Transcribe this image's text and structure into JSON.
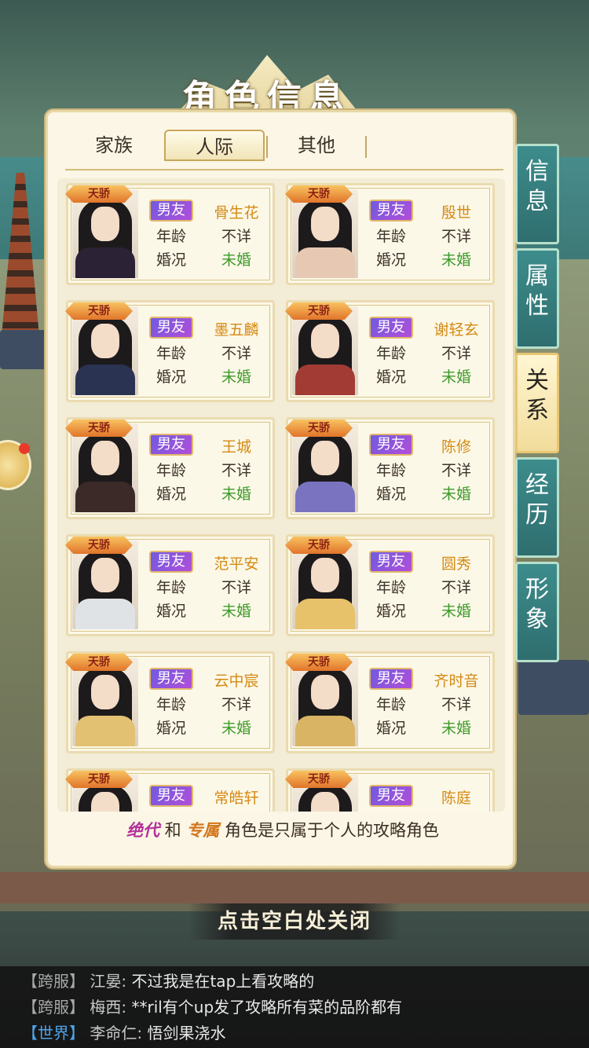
{
  "title": "角色信息",
  "tabs": [
    "家族",
    "人际",
    "其他"
  ],
  "active_tab": "人际",
  "side_tabs": [
    "信息",
    "属性",
    "关系",
    "经历",
    "形象"
  ],
  "active_side_tab": "关系",
  "labels": {
    "age": "年龄",
    "marriage": "婚况"
  },
  "characters": [
    {
      "badge": "天骄",
      "tag": "男友",
      "name": "骨生花",
      "age": "不详",
      "marriage": "未婚",
      "robe": "#2b2236"
    },
    {
      "badge": "天骄",
      "tag": "男友",
      "name": "殷世",
      "age": "不详",
      "marriage": "未婚",
      "robe": "#e7c9b3"
    },
    {
      "badge": "天骄",
      "tag": "男友",
      "name": "墨五麟",
      "age": "不详",
      "marriage": "未婚",
      "robe": "#2a3352"
    },
    {
      "badge": "天骄",
      "tag": "男友",
      "name": "谢轻玄",
      "age": "不详",
      "marriage": "未婚",
      "robe": "#a33b35"
    },
    {
      "badge": "天骄",
      "tag": "男友",
      "name": "王城",
      "age": "不详",
      "marriage": "未婚",
      "robe": "#3b2a28"
    },
    {
      "badge": "天骄",
      "tag": "男友",
      "name": "陈修",
      "age": "不详",
      "marriage": "未婚",
      "robe": "#7a74c0"
    },
    {
      "badge": "天骄",
      "tag": "男友",
      "name": "范平安",
      "age": "不详",
      "marriage": "未婚",
      "robe": "#dfe3e6"
    },
    {
      "badge": "天骄",
      "tag": "男友",
      "name": "圆秀",
      "age": "不详",
      "marriage": "未婚",
      "robe": "#e8c16b"
    },
    {
      "badge": "天骄",
      "tag": "男友",
      "name": "云中宸",
      "age": "不详",
      "marriage": "未婚",
      "robe": "#e2c173"
    },
    {
      "badge": "天骄",
      "tag": "男友",
      "name": "齐时音",
      "age": "不详",
      "marriage": "未婚",
      "robe": "#d9b464"
    },
    {
      "badge": "天骄",
      "tag": "男友",
      "name": "常皓轩",
      "age": "",
      "marriage": "",
      "robe": "#b94a4a"
    },
    {
      "badge": "天骄",
      "tag": "男友",
      "name": "陈庭",
      "age": "",
      "marriage": "",
      "robe": "#3a3a3a"
    }
  ],
  "note": {
    "part1": "绝代",
    "and": "和",
    "part2": "专属",
    "rest": "角色是只属于个人的攻略角色"
  },
  "close_hint": "点击空白处关闭",
  "chat": [
    {
      "channel": "【跨服】",
      "sender": "江晏:",
      "text": "不过我是在tap上看攻略的",
      "world": false
    },
    {
      "channel": "【跨服】",
      "sender": "梅西:",
      "text": "**ril有个up发了攻略所有菜的品阶都有",
      "world": false
    },
    {
      "channel": "【世界】",
      "sender": "李命仁:",
      "text": "悟剑果浇水",
      "world": true
    }
  ]
}
